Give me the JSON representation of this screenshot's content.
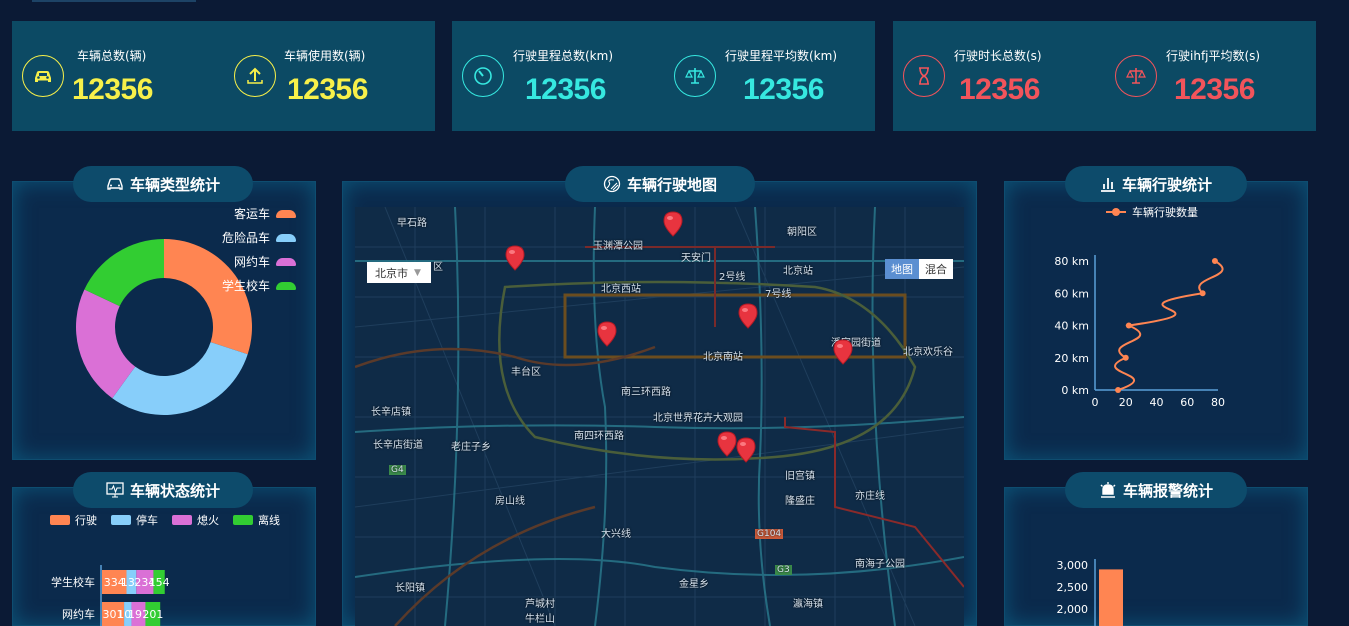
{
  "stats": [
    {
      "label": "车辆总数(辆)",
      "value": "12356",
      "icon": "car-icon",
      "color": "#f7f04a"
    },
    {
      "label": "车辆使用数(辆)",
      "value": "12356",
      "icon": "upload-circle-icon",
      "color": "#f7f04a"
    },
    {
      "label": "行驶里程总数(km)",
      "value": "12356",
      "icon": "speedometer-icon",
      "color": "#36e8e0"
    },
    {
      "label": "行驶里程平均数(km)",
      "value": "12356",
      "icon": "balance-scale-icon",
      "color": "#36e8e0"
    },
    {
      "label": "行驶时长总数(s)",
      "value": "12356",
      "icon": "hourglass-icon",
      "color": "#f2545b"
    },
    {
      "label": "行驶ihfj平均数(s)",
      "value": "12356",
      "icon": "balance-scale-icon",
      "color": "#f2545b"
    }
  ],
  "panels": {
    "type": {
      "title": "车辆类型统计",
      "icon": "car-outline-icon"
    },
    "map": {
      "title": "车辆行驶地图",
      "icon": "map-route-icon"
    },
    "drive": {
      "title": "车辆行驶统计",
      "icon": "bar-chart-icon"
    },
    "status": {
      "title": "车辆状态统计",
      "icon": "monitor-pulse-icon"
    },
    "alarm": {
      "title": "车辆报警统计",
      "icon": "alarm-light-icon"
    }
  },
  "map": {
    "city": "北京市",
    "type_active": "地图",
    "type_other": "混合",
    "labels": [
      "早石路",
      "玉渊潭公园",
      "天安门",
      "朝阳区",
      "北京西站",
      "北京站",
      "2号线",
      "7号线",
      "北京南站",
      "丰台区",
      "南三环西路",
      "潘家园街道",
      "北京欢乐谷",
      "北京世界花卉大观园",
      "长辛店镇",
      "长辛店街道",
      "老庄子乡",
      "南四环西路",
      "旧宫镇",
      "隆盛庄",
      "亦庄线",
      "房山线",
      "G4",
      "G104",
      "G3",
      "长阳镇",
      "金星乡",
      "南海子公园",
      "瀛海镇",
      "芦城村",
      "牛栏山",
      "大兴线",
      "区"
    ]
  },
  "chart_data": [
    {
      "type": "pie",
      "title": "车辆类型统计",
      "legend": [
        "客运车",
        "危险品车",
        "网约车",
        "学生校车"
      ],
      "colors": [
        "#ff8552",
        "#87cefa",
        "#da70d6",
        "#32cd32"
      ],
      "values": [
        30,
        30,
        22,
        18
      ]
    },
    {
      "type": "line",
      "title": "车辆行驶统计",
      "series": [
        {
          "name": "车辆行驶数量",
          "color": "#ff8552",
          "points": [
            [
              15,
              0
            ],
            [
              20,
              20
            ],
            [
              22,
              40
            ],
            [
              70,
              60
            ],
            [
              78,
              80
            ]
          ]
        }
      ],
      "y_ticks": [
        "0 km",
        "20 km",
        "40 km",
        "60 km",
        "80 km"
      ],
      "x_ticks": [
        "0",
        "20",
        "40",
        "60",
        "80"
      ],
      "ylim": [
        0,
        80
      ],
      "xlim": [
        0,
        80
      ]
    },
    {
      "type": "bar",
      "title": "车辆状态统计",
      "orientation": "horizontal-stacked",
      "legend": [
        "行驶",
        "停车",
        "熄火",
        "离线"
      ],
      "colors": [
        "#ff8552",
        "#87cefa",
        "#da70d6",
        "#32cd32"
      ],
      "categories": [
        "学生校车",
        "网约车"
      ],
      "series": [
        {
          "name": "行驶",
          "values": [
            334,
            301
          ]
        },
        {
          "name": "停车",
          "values": [
            134,
            101
          ]
        },
        {
          "name": "熄火",
          "values": [
            234,
            191
          ]
        },
        {
          "name": "离线",
          "values": [
            154,
            201
          ]
        }
      ]
    },
    {
      "type": "bar",
      "title": "车辆报警统计",
      "y_ticks": [
        "2,000",
        "2,500",
        "3,000"
      ],
      "values": [
        2900
      ],
      "colors": [
        "#ff8552"
      ]
    }
  ]
}
